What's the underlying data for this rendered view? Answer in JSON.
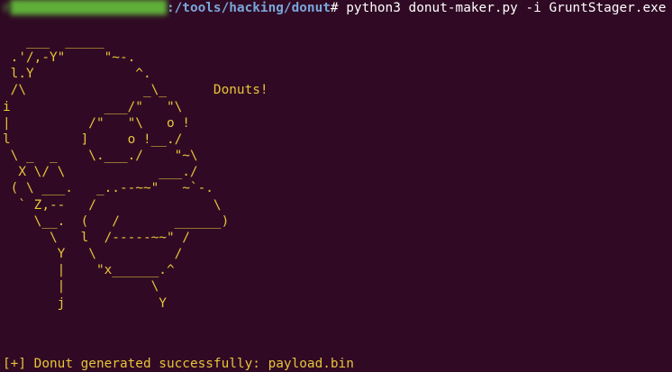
{
  "window": {
    "background": "#300a24",
    "text_color": "#e4e4e4",
    "art_color": "#e8c33a"
  },
  "prompt": {
    "user_host": "r",
    "path": ":/tools/hacking/donut",
    "symbol": "#",
    "command": " python3 donut-maker.py -i GruntStager.exe"
  },
  "ascii_art": {
    "lines": [
      "   ___  _____",
      " .'/,-Y\"     \"~-.",
      " l.Y             ^.",
      " /\\               _\\_      Donuts!",
      "i            ___/\"   \"\\",
      "|          /\"   \"\\   o !",
      "l         ]     o !__./",
      " \\ _  _    \\.___./    \"~\\",
      "  X \\/ \\            ___./",
      " ( \\ ___.   _..--~~\"   ~`-.",
      "  ` Z,--   /               \\",
      "    \\__.  (   /       ______)",
      "      \\   l  /-----~~\" /",
      "       Y   \\          /",
      "       |    \"x______.^",
      "       |           \\",
      "       j            Y"
    ]
  },
  "status": {
    "prefix": "[+]",
    "message": " Donut generated successfully: payload.bin"
  }
}
